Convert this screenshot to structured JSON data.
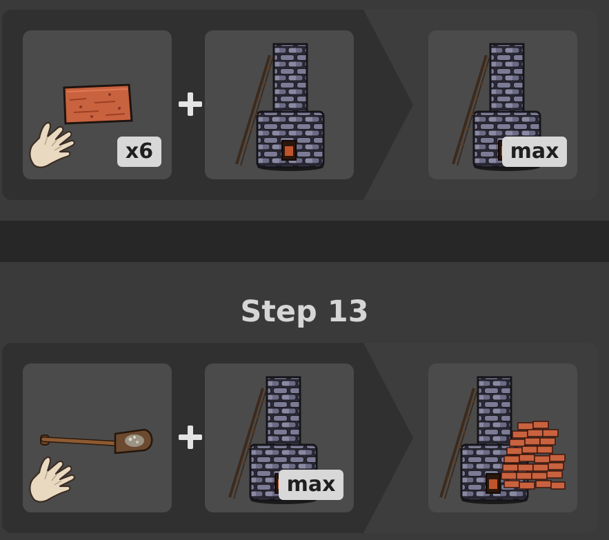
{
  "recipes": [
    {
      "left": {
        "item": "brick",
        "tool": "hand",
        "badge": "x6"
      },
      "right": {
        "item": "kiln"
      },
      "result": {
        "item": "kiln",
        "badge": "max"
      }
    },
    {
      "step_title": "Step 13",
      "left": {
        "item": "shovel-with-dirt",
        "tool": "hand"
      },
      "right": {
        "item": "kiln",
        "badge": "max"
      },
      "result": {
        "item": "kiln-with-brick-pile"
      }
    }
  ],
  "symbols": {
    "plus": "+"
  },
  "colors": {
    "page_bg": "#3a3a3a",
    "panel_bg": "#303030",
    "slot_bg": "#4b4b4b",
    "divider": "#272727",
    "badge_bg": "#d8d8d8",
    "title_text": "#d6d6d6"
  }
}
